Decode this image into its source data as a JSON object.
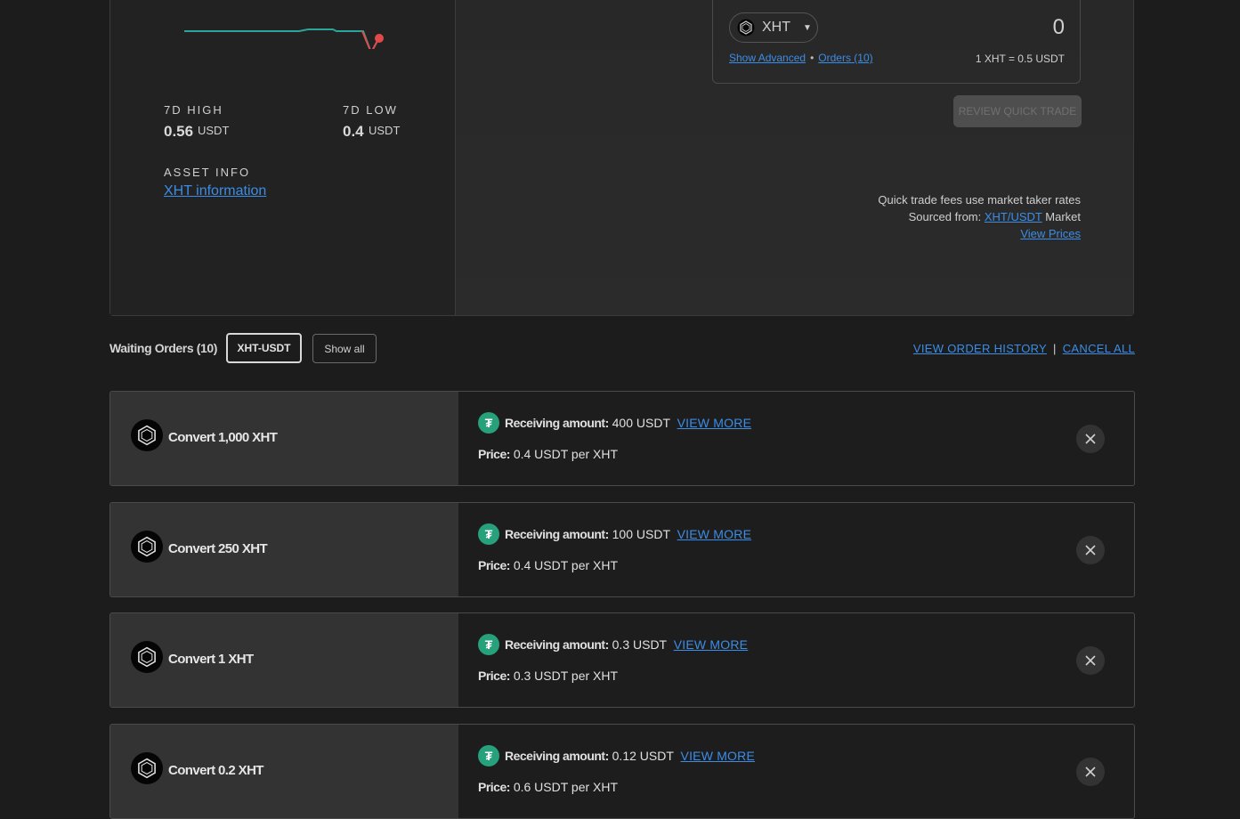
{
  "market": {
    "high_label": "7D HIGH",
    "high_value": "0.56",
    "high_unit": "USDT",
    "low_label": "7D LOW",
    "low_value": "0.4",
    "low_unit": "USDT",
    "asset_info_label": "ASSET INFO",
    "asset_info_link": "XHT information",
    "sparkline_color": "#2aa59a",
    "sparkline_end_color": "#e24a4a"
  },
  "trade": {
    "coin": "XHT",
    "amount": "0",
    "show_advanced": "Show Advanced",
    "separator": "•",
    "orders_link": "Orders (10)",
    "rate": "1 XHT = 0.5 USDT",
    "review_button": "REVIEW QUICK TRADE",
    "fees_note": "Quick trade fees use market taker rates",
    "sourced_label": "Sourced from:",
    "sourced_link": "XHT/USDT",
    "sourced_suffix": "Market",
    "view_prices": "View Prices"
  },
  "orders_header": {
    "title": "Waiting Orders (10)",
    "pair_button": "XHT-USDT",
    "show_all_button": "Show all",
    "view_history": "VIEW ORDER HISTORY",
    "separator": "|",
    "cancel_all": "CANCEL ALL"
  },
  "orders": [
    {
      "title": "Convert 1,000 XHT",
      "receiving_label": "Receiving amount:",
      "receiving": "400 USDT",
      "view_more": "VIEW MORE",
      "price_label": "Price:",
      "price": "0.4 USDT per XHT"
    },
    {
      "title": "Convert 250 XHT",
      "receiving_label": "Receiving amount:",
      "receiving": "100 USDT",
      "view_more": "VIEW MORE",
      "price_label": "Price:",
      "price": "0.4 USDT per XHT"
    },
    {
      "title": "Convert 1 XHT",
      "receiving_label": "Receiving amount:",
      "receiving": "0.3 USDT",
      "view_more": "VIEW MORE",
      "price_label": "Price:",
      "price": "0.3 USDT per XHT"
    },
    {
      "title": "Convert 0.2 XHT",
      "receiving_label": "Receiving amount:",
      "receiving": "0.12 USDT",
      "view_more": "VIEW MORE",
      "price_label": "Price:",
      "price": "0.6 USDT per XHT"
    }
  ],
  "icons": {
    "coin": "xht-coin-icon",
    "tether": "tether-icon",
    "cancel": "close-icon",
    "dropdown": "caret-down-icon"
  },
  "tether_glyph": "₮"
}
